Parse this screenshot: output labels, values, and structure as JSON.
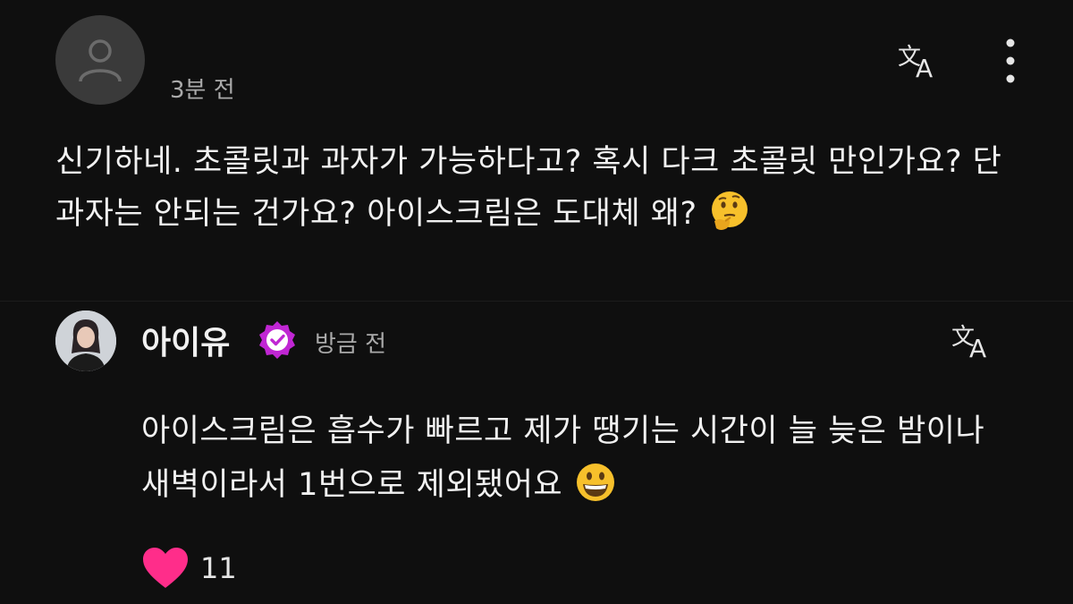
{
  "top_comment": {
    "avatar_icon": "default-user-icon",
    "timestamp": "3분 전",
    "translate_icon": "translate-icon",
    "more_icon": "more-vertical-icon",
    "text": "신기하네. 초콜릿과 과자가 가능하다고? 혹시 다크 초콜릿 만인가요? 단 과자는 안되는 건가요? 아이스크림은 도대체 왜? ",
    "emoji": "thinking-face"
  },
  "reply": {
    "author": "아이유",
    "verified_icon": "verified-badge-icon",
    "timestamp": "방금 전",
    "translate_icon": "translate-icon",
    "text": "아이스크림은 흡수가 빠르고 제가 땡기는 시간이 늘 늦은 밤이나 새벽이라서 1번으로 제외됐어요 ",
    "emoji": "grinning-face",
    "likes": "11",
    "like_icon": "heart-icon",
    "colors": {
      "heart": "#ff2d8a",
      "verified": "#c026d3"
    }
  }
}
